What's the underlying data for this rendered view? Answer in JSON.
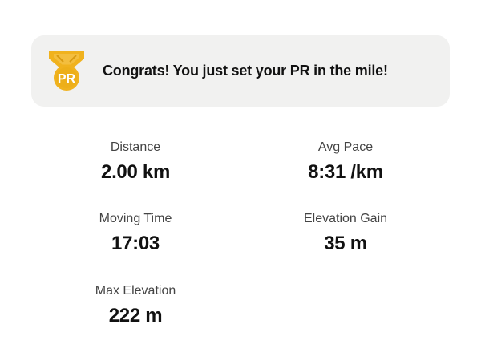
{
  "banner": {
    "icon": "pr-medal-icon",
    "icon_text": "PR",
    "message": "Congrats! You just set your PR in the mile!",
    "accent_color": "#F0B21E",
    "background_color": "#F1F1F0"
  },
  "stats": {
    "distance": {
      "label": "Distance",
      "value": "2.00 km"
    },
    "avg_pace": {
      "label": "Avg Pace",
      "value": "8:31 /km"
    },
    "moving_time": {
      "label": "Moving Time",
      "value": "17:03"
    },
    "elevation_gain": {
      "label": "Elevation Gain",
      "value": "35 m"
    },
    "max_elevation": {
      "label": "Max Elevation",
      "value": "222 m"
    }
  }
}
